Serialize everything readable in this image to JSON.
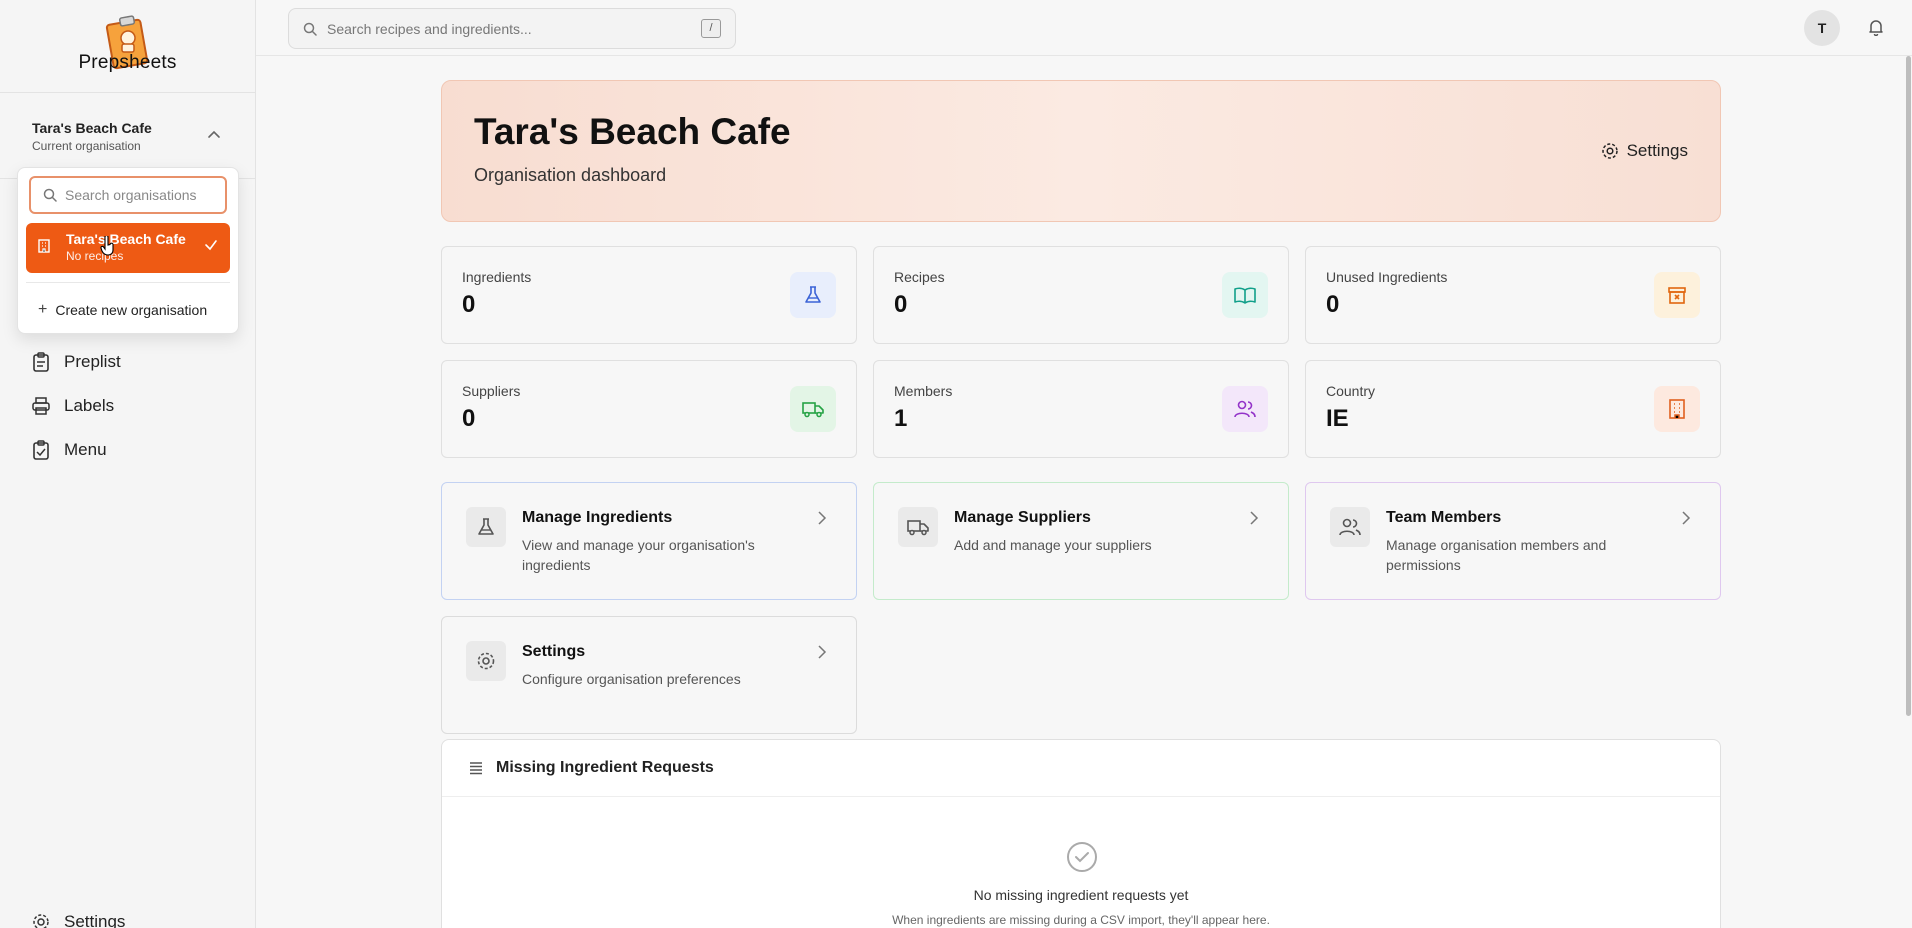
{
  "app": {
    "name": "Prepsheets"
  },
  "search": {
    "placeholder": "Search recipes and ingredients...",
    "shortcut": "/"
  },
  "user": {
    "initial": "T"
  },
  "org_switcher": {
    "name": "Tara's Beach Cafe",
    "subtitle": "Current organisation"
  },
  "dropdown": {
    "search_placeholder": "Search organisations",
    "items": [
      {
        "name": "Tara's Beach Cafe",
        "sub": "No recipes",
        "selected": true
      }
    ],
    "create_label": "Create new organisation"
  },
  "sidebar": {
    "items": [
      {
        "label": "Preplist",
        "icon": "clipboard-icon"
      },
      {
        "label": "Labels",
        "icon": "printer-icon"
      },
      {
        "label": "Menu",
        "icon": "menu-book-icon"
      }
    ],
    "bottom_label": "Settings"
  },
  "hero": {
    "title": "Tara's Beach Cafe",
    "subtitle": "Organisation dashboard",
    "settings_label": "Settings"
  },
  "stats": [
    {
      "label": "Ingredients",
      "value": "0",
      "icon": "flask-icon",
      "color": "#3b63d6",
      "bg": "#e8eefc"
    },
    {
      "label": "Recipes",
      "value": "0",
      "icon": "book-open-icon",
      "color": "#11a08a",
      "bg": "#e3f6f1"
    },
    {
      "label": "Unused Ingredients",
      "value": "0",
      "icon": "archive-x-icon",
      "color": "#e1670f",
      "bg": "#fdf1dc"
    },
    {
      "label": "Suppliers",
      "value": "0",
      "icon": "truck-icon",
      "color": "#25a244",
      "bg": "#e3f5e6"
    },
    {
      "label": "Members",
      "value": "1",
      "icon": "users-icon",
      "color": "#9333c9",
      "bg": "#f3e7fa"
    },
    {
      "label": "Country",
      "value": "IE",
      "icon": "building-icon",
      "color": "#e0601f",
      "bg": "#fde9df"
    }
  ],
  "cards": [
    {
      "title": "Manage Ingredients",
      "desc": "View and manage your organisation's ingredients",
      "icon": "flask-icon",
      "border": "#c3d2f2"
    },
    {
      "title": "Manage Suppliers",
      "desc": "Add and manage your suppliers",
      "icon": "truck-icon",
      "border": "#c4ebcb"
    },
    {
      "title": "Team Members",
      "desc": "Manage organisation members and permissions",
      "icon": "users-icon",
      "border": "#dfc8ef"
    },
    {
      "title": "Settings",
      "desc": "Configure organisation preferences",
      "icon": "gear-icon",
      "border": "#dcdcdc"
    }
  ],
  "missing": {
    "title": "Missing Ingredient Requests",
    "empty_title": "No missing ingredient requests yet",
    "empty_sub": "When ingredients are missing during a CSV import, they'll appear here."
  }
}
